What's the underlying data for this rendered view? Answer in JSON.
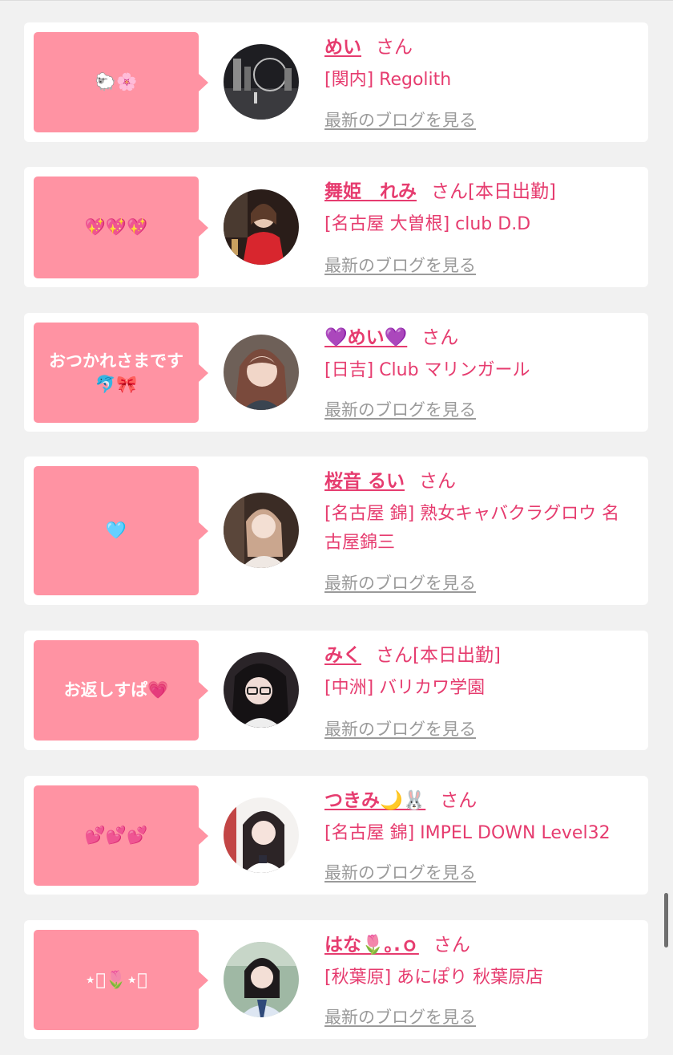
{
  "theme": {
    "accent": "#e63c6f",
    "bubble": "#ff93a3",
    "link_gray": "#9a9a9a",
    "background": "#f1f1f1"
  },
  "entries": [
    {
      "message": "🐑🌸",
      "name": "めい",
      "honorific": "さん",
      "status": "",
      "shop": "[関内] Regolith",
      "blog_link": "最新のブログを見る",
      "avatar": "night-city-photo"
    },
    {
      "message": "💖💖💖",
      "name": "舞姫　れみ",
      "honorific": "さん",
      "status": "[本日出勤]",
      "shop": "[名古屋 大曽根] club D.D",
      "blog_link": "最新のブログを見る",
      "avatar": "red-dress-photo"
    },
    {
      "message": "おつかれさまです\n🐬🎀",
      "name": "💜めい💜",
      "honorific": "さん",
      "status": "",
      "shop": "[日吉] Club マリンガール",
      "blog_link": "最新のブログを見る",
      "avatar": "selfie-photo"
    },
    {
      "message": "🩵",
      "name": "桜音 るい",
      "honorific": "さん",
      "status": "",
      "shop": "[名古屋 錦] 熟女キャバクラグロウ 名古屋錦三",
      "blog_link": "最新のブログを見る",
      "avatar": "portrait-photo"
    },
    {
      "message": "お返しすぱ💗",
      "name": "みく",
      "honorific": "さん",
      "status": "[本日出勤]",
      "shop": "[中洲] バリカワ学園",
      "blog_link": "最新のブログを見る",
      "avatar": "glasses-selfie-photo"
    },
    {
      "message": "💕💕💕",
      "name": "つきみ🌙🐰",
      "honorific": "さん",
      "status": "",
      "shop": "[名古屋 錦] IMPEL DOWN Level32",
      "blog_link": "最新のブログを見る",
      "avatar": "pose-photo"
    },
    {
      "message": "⋆͛🌷⋆͛",
      "name": "はな🌷｡.ｏ",
      "honorific": "さん",
      "status": "",
      "shop": "[秋葉原] あにぽり 秋葉原店",
      "blog_link": "最新のブログを見る",
      "avatar": "uniform-photo"
    }
  ]
}
